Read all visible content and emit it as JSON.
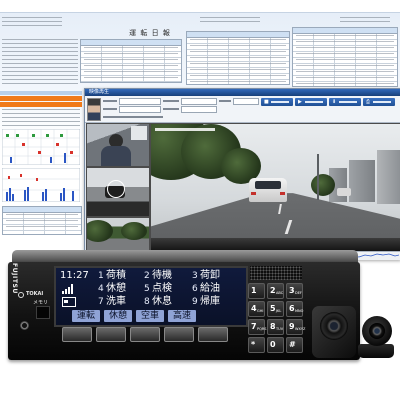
{
  "report": {
    "title": "運 転 日 報"
  },
  "player": {
    "title": "映像再生",
    "button_icons": [
      "stop-icon",
      "play-icon",
      "download-icon",
      "export-icon"
    ]
  },
  "device": {
    "brand": "FUJITSU",
    "badge": "TOKAI",
    "slot_label": "メモリ",
    "display": {
      "time": "11:27",
      "status_icons": [
        "signal-icon",
        "card-icon"
      ],
      "rows": [
        [
          {
            "num": "1",
            "label": "荷積"
          },
          {
            "num": "2",
            "label": "待機"
          },
          {
            "num": "3",
            "label": "荷卸"
          }
        ],
        [
          {
            "num": "4",
            "label": "休憩"
          },
          {
            "num": "5",
            "label": "点検"
          },
          {
            "num": "6",
            "label": "給油"
          }
        ],
        [
          {
            "num": "7",
            "label": "洗車"
          },
          {
            "num": "8",
            "label": "休息"
          },
          {
            "num": "9",
            "label": "帰庫"
          }
        ]
      ],
      "softkeys": [
        "運転",
        "休憩",
        "空車",
        "高速"
      ]
    },
    "keypad": [
      {
        "num": "1",
        "letters": ""
      },
      {
        "num": "2",
        "letters": "ABC"
      },
      {
        "num": "3",
        "letters": "DEF"
      },
      {
        "num": "4",
        "letters": "GHI"
      },
      {
        "num": "5",
        "letters": "JKL"
      },
      {
        "num": "6",
        "letters": "MNO"
      },
      {
        "num": "7",
        "letters": "PQRS"
      },
      {
        "num": "8",
        "letters": "TUV"
      },
      {
        "num": "9",
        "letters": "WXYZ"
      },
      {
        "num": "*",
        "letters": ""
      },
      {
        "num": "0",
        "letters": ""
      },
      {
        "num": "#",
        "letters": ""
      }
    ]
  },
  "colors": {
    "lcd_background": "#0c1431",
    "player_titlebar": "#1f4f9c",
    "player_button": "#2a5fae",
    "report_highlight_row": "#f07a1a",
    "device_body": "#111111"
  }
}
